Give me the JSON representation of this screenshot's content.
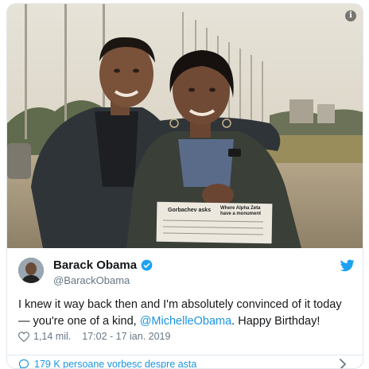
{
  "photo": {
    "alt_subject": "photo",
    "newspaper_headline_left": "Gorbachev asks",
    "newspaper_headline_right": "Where Alpha Zeta\nhave a monument"
  },
  "tweet": {
    "author_name": "Barack Obama",
    "author_handle": "@BarackObama",
    "text_before": "I knew it way back then and I'm absolutely convinced of it today — you're one of a kind, ",
    "mention": "@MichelleObama",
    "text_after": ". Happy Birthday!",
    "likes": "1,14 mil.",
    "timestamp": "17:02 - 17 ian. 2019",
    "conversation": "179 K persoane vorbesc despre asta"
  },
  "icons": {
    "info": "info-icon",
    "verified": "verified-badge-icon",
    "platform": "twitter-bird-icon",
    "like": "heart-icon",
    "reply": "speech-bubble-icon",
    "more": "chevron-right-icon"
  },
  "colors": {
    "link": "#1b95e0",
    "muted": "#657786",
    "text": "#14171a",
    "border": "#e1e8ed"
  }
}
